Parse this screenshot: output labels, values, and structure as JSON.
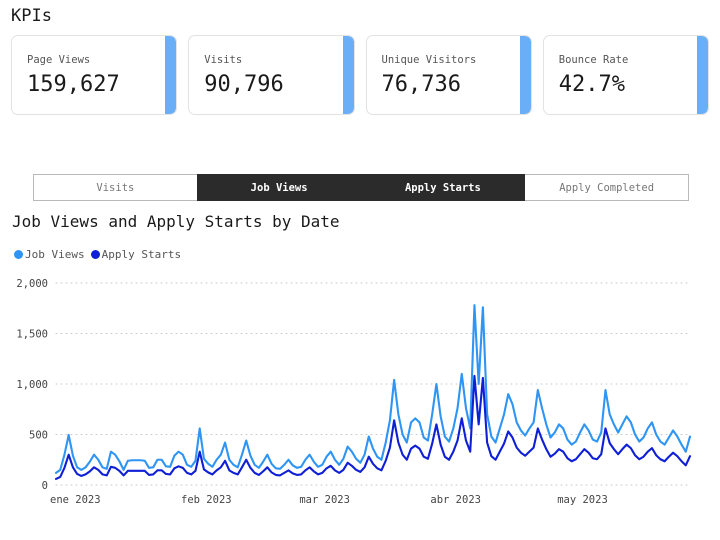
{
  "kpi": {
    "heading": "KPIs",
    "accent_color": "#6aaef7",
    "cards": [
      {
        "label": "Page Views",
        "value": "159,627"
      },
      {
        "label": "Visits",
        "value": "90,796"
      },
      {
        "label": "Unique Visitors",
        "value": "76,736"
      },
      {
        "label": "Bounce Rate",
        "value": "42.7%"
      }
    ]
  },
  "tabs": {
    "active_color": "#2b2b2b",
    "items": [
      {
        "label": "Visits",
        "active": false
      },
      {
        "label": "Job Views",
        "active": true
      },
      {
        "label": "Apply Starts",
        "active": true
      },
      {
        "label": "Apply Completed",
        "active": false
      }
    ]
  },
  "chart_data": {
    "type": "line",
    "title": "Job Views and Apply Starts by Date",
    "xlabel": "",
    "ylabel": "",
    "ylim": [
      0,
      2000
    ],
    "yticks": [
      0,
      500,
      1000,
      1500,
      2000
    ],
    "ytick_labels": [
      "0",
      "500",
      "1,000",
      "1,500",
      "2,000"
    ],
    "grid": true,
    "grid_style": "dotted",
    "legend_position": "top-left",
    "x_tick_labels": [
      "ene 2023",
      "feb 2023",
      "mar 2023",
      "abr 2023",
      "may 2023"
    ],
    "x_tick_indices": [
      0,
      31,
      59,
      90,
      120
    ],
    "x_count": 151,
    "series": [
      {
        "name": "Job Views",
        "color": "#2e95f5",
        "values": [
          120,
          150,
          300,
          495,
          290,
          175,
          150,
          175,
          230,
          300,
          250,
          175,
          160,
          330,
          300,
          235,
          150,
          240,
          245,
          245,
          245,
          240,
          170,
          175,
          250,
          250,
          185,
          180,
          290,
          330,
          300,
          200,
          180,
          240,
          560,
          260,
          210,
          180,
          250,
          300,
          420,
          250,
          200,
          175,
          300,
          440,
          290,
          200,
          170,
          230,
          300,
          210,
          165,
          160,
          200,
          250,
          195,
          170,
          180,
          250,
          300,
          230,
          180,
          200,
          280,
          330,
          250,
          200,
          260,
          380,
          330,
          260,
          220,
          300,
          480,
          360,
          280,
          250,
          420,
          640,
          1040,
          700,
          500,
          420,
          620,
          660,
          620,
          470,
          440,
          700,
          1000,
          680,
          480,
          430,
          560,
          760,
          1100,
          760,
          560,
          1780,
          1000,
          1760,
          700,
          480,
          420,
          560,
          700,
          900,
          800,
          620,
          540,
          490,
          560,
          620,
          940,
          760,
          600,
          470,
          520,
          600,
          560,
          450,
          400,
          430,
          520,
          600,
          540,
          450,
          430,
          520,
          940,
          700,
          600,
          520,
          600,
          680,
          620,
          500,
          430,
          470,
          560,
          620,
          500,
          430,
          400,
          470,
          540,
          480,
          400,
          330,
          480
        ]
      },
      {
        "name": "Apply Starts",
        "color": "#0e1fd6",
        "values": [
          60,
          80,
          170,
          300,
          175,
          110,
          90,
          105,
          135,
          175,
          150,
          105,
          95,
          180,
          170,
          140,
          95,
          140,
          140,
          140,
          140,
          140,
          100,
          105,
          145,
          145,
          110,
          105,
          165,
          185,
          170,
          120,
          105,
          140,
          330,
          155,
          125,
          105,
          145,
          175,
          240,
          145,
          120,
          105,
          175,
          250,
          170,
          120,
          100,
          135,
          175,
          125,
          100,
          95,
          120,
          145,
          115,
          100,
          105,
          145,
          175,
          135,
          105,
          120,
          165,
          190,
          145,
          120,
          150,
          220,
          190,
          150,
          130,
          175,
          280,
          210,
          165,
          145,
          240,
          370,
          640,
          420,
          300,
          250,
          360,
          390,
          360,
          280,
          260,
          410,
          600,
          400,
          280,
          250,
          330,
          440,
          660,
          440,
          330,
          1080,
          600,
          1060,
          420,
          285,
          250,
          330,
          410,
          530,
          470,
          370,
          320,
          290,
          330,
          370,
          560,
          450,
          355,
          280,
          310,
          355,
          330,
          265,
          235,
          255,
          305,
          355,
          320,
          265,
          255,
          305,
          560,
          415,
          355,
          305,
          355,
          400,
          365,
          295,
          255,
          280,
          330,
          365,
          295,
          255,
          235,
          280,
          320,
          285,
          235,
          195,
          285
        ]
      }
    ]
  }
}
